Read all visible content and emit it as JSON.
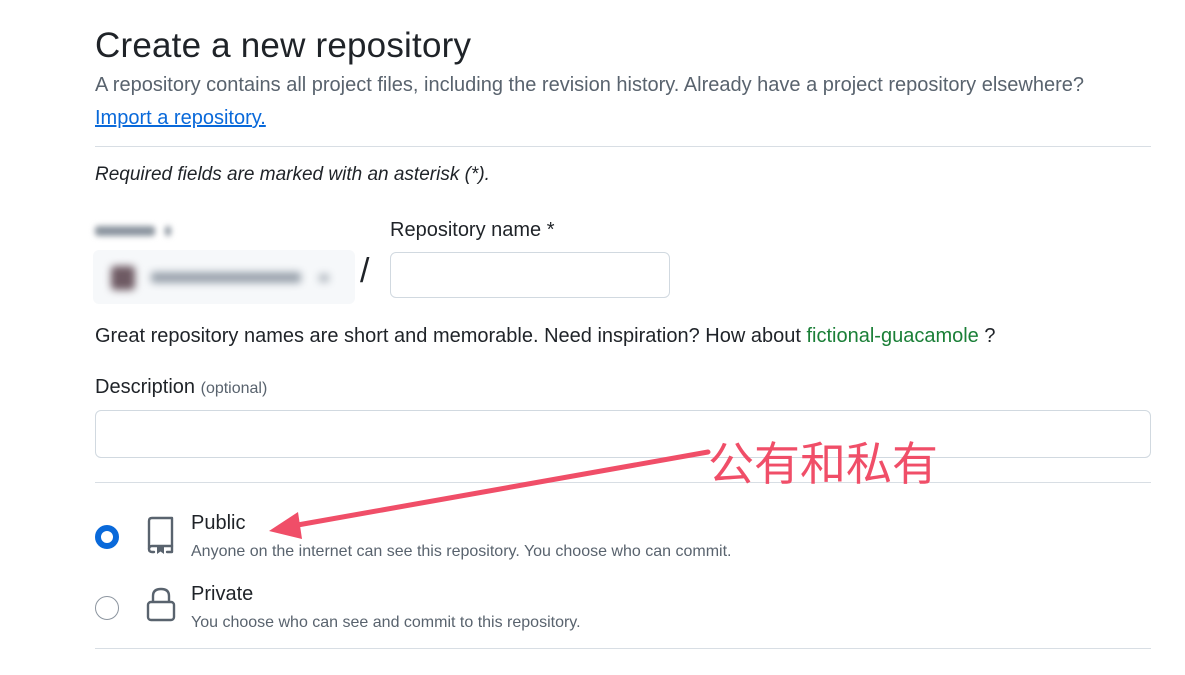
{
  "header": {
    "title": "Create a new repository",
    "intro": "A repository contains all project files, including the revision history. Already have a project repository elsewhere?",
    "import_link": "Import a repository."
  },
  "form": {
    "required_note": "Required fields are marked with an asterisk (*).",
    "owner": {
      "separator": "/"
    },
    "repo_name": {
      "label": "Repository name *",
      "value": ""
    },
    "suggestion": {
      "prefix": "Great repository names are short and memorable. Need inspiration? How about ",
      "name": "fictional-guacamole",
      "suffix": " ?"
    },
    "description": {
      "label": "Description",
      "optional": "(optional)",
      "value": ""
    },
    "visibility": {
      "options": [
        {
          "label": "Public",
          "description": "Anyone on the internet can see this repository. You choose who can commit.",
          "icon": "repo-icon",
          "selected": true
        },
        {
          "label": "Private",
          "description": "You choose who can see and commit to this repository.",
          "icon": "lock-icon",
          "selected": false
        }
      ]
    }
  },
  "annotation": {
    "text": "公有和私有",
    "color": "#f04e68"
  },
  "colors": {
    "accent": "#0969da",
    "link_green": "#1a7f37",
    "muted": "#59636e",
    "border": "#d1d9e0"
  }
}
